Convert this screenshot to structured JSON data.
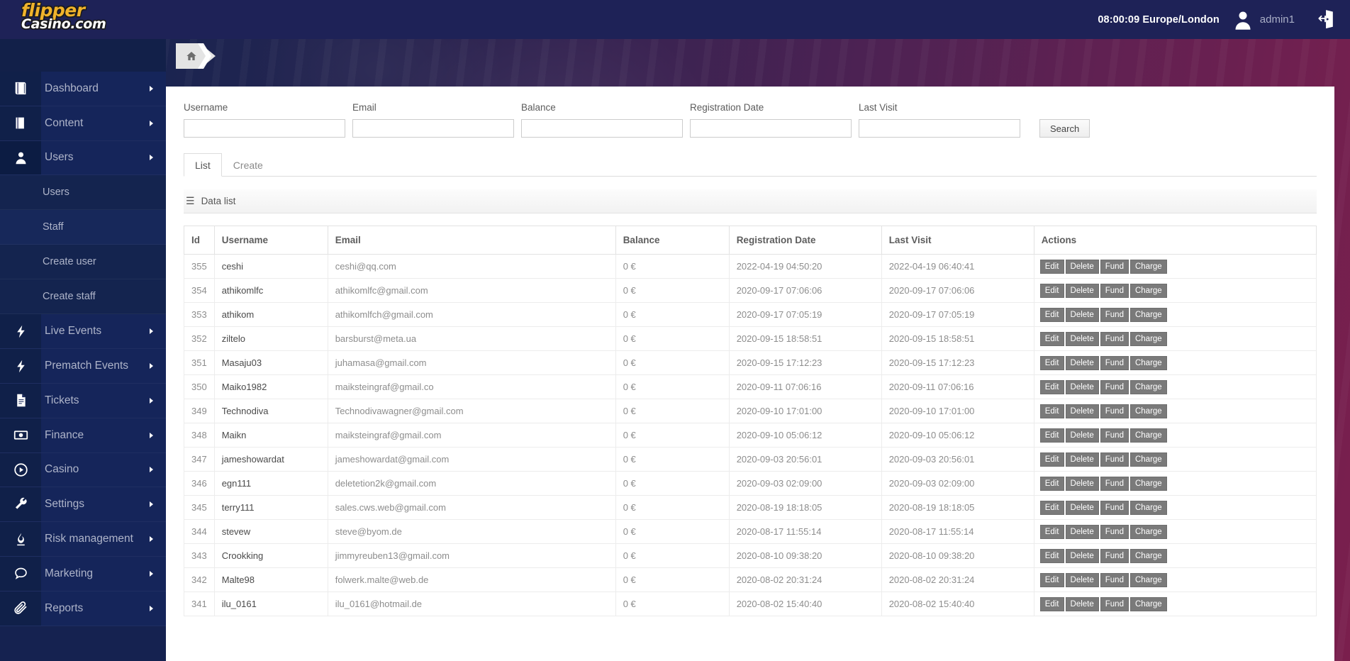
{
  "brand": {
    "line1": "flipper",
    "line2": "Casino.com"
  },
  "topbar": {
    "clock": "08:00:09 Europe/London",
    "username": "admin1",
    "avatar_icon": "user-avatar-icon",
    "logout_icon": "logout-door-icon"
  },
  "sidebar": {
    "items": [
      {
        "label": "Dashboard",
        "icon": "book-icon",
        "has_arrow": true
      },
      {
        "label": "Content",
        "icon": "book-icon",
        "has_arrow": true
      },
      {
        "label": "Users",
        "icon": "user-icon",
        "has_arrow": true,
        "active": true
      },
      {
        "label": "Live Events",
        "icon": "bolt-icon",
        "has_arrow": true
      },
      {
        "label": "Prematch Events",
        "icon": "bolt-icon",
        "has_arrow": true
      },
      {
        "label": "Tickets",
        "icon": "file-icon",
        "has_arrow": true
      },
      {
        "label": "Finance",
        "icon": "banknote-icon",
        "has_arrow": true
      },
      {
        "label": "Casino",
        "icon": "play-circle-icon",
        "has_arrow": true
      },
      {
        "label": "Settings",
        "icon": "wrench-icon",
        "has_arrow": true
      },
      {
        "label": "Risk management",
        "icon": "flame-icon",
        "has_arrow": true
      },
      {
        "label": "Marketing",
        "icon": "chat-icon",
        "has_arrow": true
      },
      {
        "label": "Reports",
        "icon": "paperclip-icon",
        "has_arrow": true
      }
    ],
    "subitems": [
      {
        "label": "Users",
        "selected": false
      },
      {
        "label": "Staff",
        "selected": true
      },
      {
        "label": "Create user",
        "selected": false
      },
      {
        "label": "Create staff",
        "selected": false
      }
    ],
    "collapse_icon": "chevron-left-icon"
  },
  "breadcrumb": {
    "home_icon": "home-icon"
  },
  "search": {
    "fields": [
      {
        "label": "Username",
        "value": "",
        "placeholder": ""
      },
      {
        "label": "Email",
        "value": "",
        "placeholder": ""
      },
      {
        "label": "Balance",
        "value": "",
        "placeholder": ""
      },
      {
        "label": "Registration Date",
        "value": "",
        "placeholder": ""
      },
      {
        "label": "Last Visit",
        "value": "",
        "placeholder": ""
      }
    ],
    "button_label": "Search"
  },
  "tabs": [
    {
      "label": "List",
      "active": true
    },
    {
      "label": "Create",
      "active": false
    }
  ],
  "datalist": {
    "title": "Data list",
    "menu_icon": "hamburger-icon",
    "columns": [
      "Id",
      "Username",
      "Email",
      "Balance",
      "Registration Date",
      "Last Visit",
      "Actions"
    ],
    "action_labels": [
      "Edit",
      "Delete",
      "Fund",
      "Charge"
    ],
    "rows": [
      {
        "id": "355",
        "username": "ceshi",
        "email": "ceshi@qq.com",
        "balance": "0 €",
        "registration": "2022-04-19 04:50:20",
        "last_visit": "2022-04-19 06:40:41"
      },
      {
        "id": "354",
        "username": "athikomlfc",
        "email": "athikomlfc@gmail.com",
        "balance": "0 €",
        "registration": "2020-09-17 07:06:06",
        "last_visit": "2020-09-17 07:06:06"
      },
      {
        "id": "353",
        "username": "athikom",
        "email": "athikomlfch@gmail.com",
        "balance": "0 €",
        "registration": "2020-09-17 07:05:19",
        "last_visit": "2020-09-17 07:05:19"
      },
      {
        "id": "352",
        "username": "ziltelo",
        "email": "barsburst@meta.ua",
        "balance": "0 €",
        "registration": "2020-09-15 18:58:51",
        "last_visit": "2020-09-15 18:58:51"
      },
      {
        "id": "351",
        "username": "Masaju03",
        "email": "juhamasa@gmail.com",
        "balance": "0 €",
        "registration": "2020-09-15 17:12:23",
        "last_visit": "2020-09-15 17:12:23"
      },
      {
        "id": "350",
        "username": "Maiko1982",
        "email": "maiksteingraf@gmail.co",
        "balance": "0 €",
        "registration": "2020-09-11 07:06:16",
        "last_visit": "2020-09-11 07:06:16"
      },
      {
        "id": "349",
        "username": "Technodiva",
        "email": "Technodivawagner@gmail.com",
        "balance": "0 €",
        "registration": "2020-09-10 17:01:00",
        "last_visit": "2020-09-10 17:01:00"
      },
      {
        "id": "348",
        "username": "Maikn",
        "email": "maiksteingraf@gmail.com",
        "balance": "0 €",
        "registration": "2020-09-10 05:06:12",
        "last_visit": "2020-09-10 05:06:12"
      },
      {
        "id": "347",
        "username": "jameshowardat",
        "email": "jameshowardat@gmail.com",
        "balance": "0 €",
        "registration": "2020-09-03 20:56:01",
        "last_visit": "2020-09-03 20:56:01"
      },
      {
        "id": "346",
        "username": "egn111",
        "email": "deletetion2k@gmail.com",
        "balance": "0 €",
        "registration": "2020-09-03 02:09:00",
        "last_visit": "2020-09-03 02:09:00"
      },
      {
        "id": "345",
        "username": "terry111",
        "email": "sales.cws.web@gmail.com",
        "balance": "0 €",
        "registration": "2020-08-19 18:18:05",
        "last_visit": "2020-08-19 18:18:05"
      },
      {
        "id": "344",
        "username": "stevew",
        "email": "steve@byom.de",
        "balance": "0 €",
        "registration": "2020-08-17 11:55:14",
        "last_visit": "2020-08-17 11:55:14"
      },
      {
        "id": "343",
        "username": "Crookking",
        "email": "jimmyreuben13@gmail.com",
        "balance": "0 €",
        "registration": "2020-08-10 09:38:20",
        "last_visit": "2020-08-10 09:38:20"
      },
      {
        "id": "342",
        "username": "Malte98",
        "email": "folwerk.malte@web.de",
        "balance": "0 €",
        "registration": "2020-08-02 20:31:24",
        "last_visit": "2020-08-02 20:31:24"
      },
      {
        "id": "341",
        "username": "ilu_0161",
        "email": "ilu_0161@hotmail.de",
        "balance": "0 €",
        "registration": "2020-08-02 15:40:40",
        "last_visit": "2020-08-02 15:40:40"
      }
    ]
  },
  "colors": {
    "topbar_bg": "#1e2257",
    "sidebar_bg": "#15255a",
    "brand_gold": "#f0b32c",
    "action_button": "#7a7a7a"
  }
}
